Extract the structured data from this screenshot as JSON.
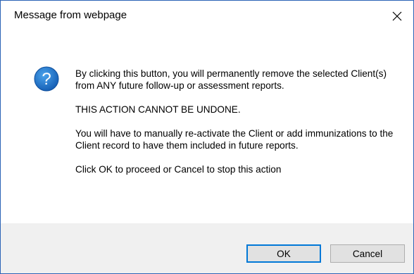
{
  "dialog": {
    "title": "Message from webpage",
    "close_icon": "close-icon",
    "icon": "question-icon",
    "icon_color": "#1e74c6",
    "message": {
      "line1": "By clicking this button, you will permanently remove the selected Client(s) from ANY future follow-up or assessment reports.",
      "line2": "THIS ACTION CANNOT BE UNDONE.",
      "line3": "You will have to manually re-activate the Client or add immunizations to the Client record to have them included in future reports.",
      "line4": "Click OK to proceed or Cancel to stop this action"
    },
    "buttons": {
      "ok_label": "OK",
      "cancel_label": "Cancel"
    },
    "accent_color": "#0078d7"
  }
}
